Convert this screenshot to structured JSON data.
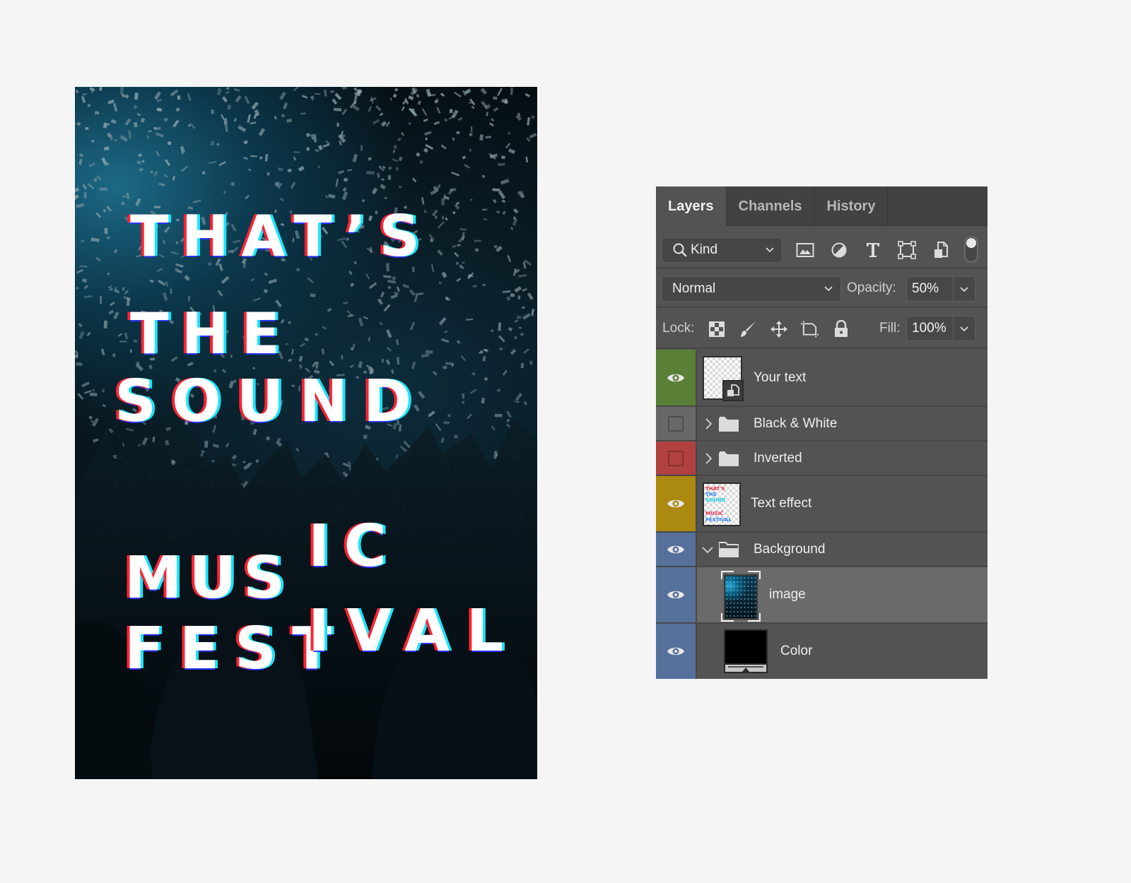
{
  "poster": {
    "lines": [
      "THAT’S",
      "THE",
      "SOUND",
      "MUS",
      "IC",
      "FEST",
      "IVAL"
    ],
    "colors": {
      "red": "#ff2333",
      "cyan": "#18e6ff",
      "blue": "#2a34ff",
      "text": "#ffffff"
    }
  },
  "panel": {
    "tabs": [
      {
        "label": "Layers",
        "active": true
      },
      {
        "label": "Channels",
        "active": false
      },
      {
        "label": "History",
        "active": false
      }
    ],
    "filter": {
      "kind_label": "Kind",
      "icons": [
        "image-filter-icon",
        "adjustment-filter-icon",
        "type-filter-icon",
        "shape-filter-icon",
        "smart-object-filter-icon"
      ],
      "toggle_on": true
    },
    "blend": {
      "mode": "Normal",
      "opacity_label": "Opacity:",
      "opacity": "50%"
    },
    "lock": {
      "label": "Lock:",
      "icons": [
        "lock-transparent-icon",
        "lock-pixels-icon",
        "lock-position-icon",
        "lock-artboard-icon",
        "lock-all-icon"
      ],
      "fill_label": "Fill:",
      "fill": "100%"
    },
    "layers": [
      {
        "name": "Your text",
        "visible": true,
        "color": "#5a8037",
        "type": "smart-object"
      },
      {
        "name": "Black & White",
        "visible": false,
        "color": "#686868",
        "type": "group",
        "expanded": false
      },
      {
        "name": "Inverted",
        "visible": false,
        "color": "#b04140",
        "type": "group",
        "expanded": false
      },
      {
        "name": "Text effect",
        "visible": true,
        "color": "#ac8a10",
        "type": "pixel"
      },
      {
        "name": "Background",
        "visible": true,
        "color": "#55709b",
        "type": "group",
        "expanded": true
      },
      {
        "name": "image",
        "visible": true,
        "color": "#55709b",
        "type": "pixel",
        "selected": true
      },
      {
        "name": "Color",
        "visible": true,
        "color": "#55709b",
        "type": "fill"
      }
    ]
  }
}
